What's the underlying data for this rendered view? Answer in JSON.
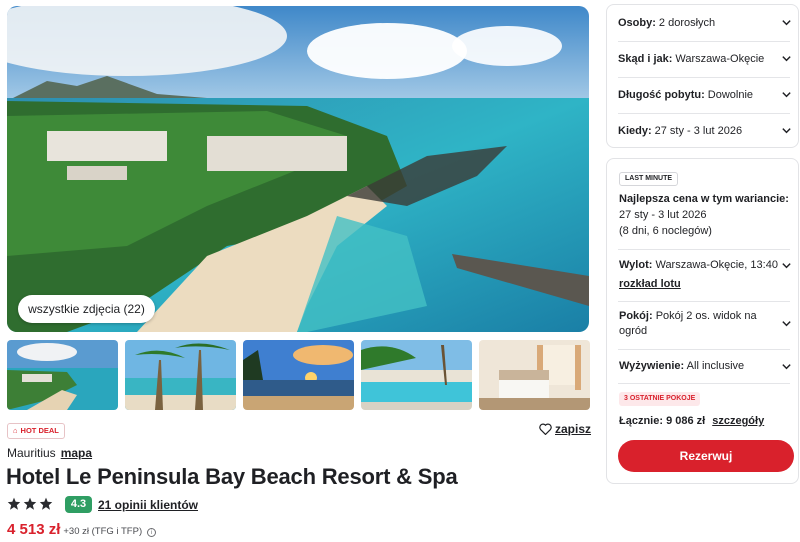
{
  "gallery": {
    "all_photos_label": "wszystkie zdjęcia (22)",
    "thumbnails": [
      "resort-aerial",
      "palm-beach",
      "sunset-beach",
      "pool-area",
      "hotel-room"
    ]
  },
  "hotel": {
    "hot_deal_label": "HOT DEAL",
    "save_label": "zapisz",
    "country": "Mauritius",
    "map_label": "mapa",
    "name": "Hotel Le Peninsula Bay Beach Resort & Spa",
    "stars": 3,
    "rating": "4.3",
    "reviews_label": "21 opinii klientów",
    "price": "4 513 zł",
    "price_extra": "+30 zł (TFG i TFP)"
  },
  "selection": {
    "persons": {
      "label": "Osoby:",
      "value": "2 dorosłych"
    },
    "departure": {
      "label": "Skąd i jak:",
      "value": "Warszawa-Okęcie"
    },
    "duration": {
      "label": "Długość pobytu:",
      "value": "Dowolnie"
    },
    "dates": {
      "label": "Kiedy:",
      "value": "27 sty - 3 lut 2026"
    }
  },
  "offer": {
    "badge": "LAST MINUTE",
    "best_price_label": "Najlepsza cena w tym wariancie:",
    "dates": "27 sty - 3 lut 2026",
    "nights": "(8 dni, 6 noclegów)",
    "flight": {
      "label": "Wylot:",
      "value": "Warszawa-Okęcie, 13:40"
    },
    "flight_schedule_label": "rozkład lotu",
    "room": {
      "label": "Pokój:",
      "value": "Pokój 2 os. widok na ogród"
    },
    "board": {
      "label": "Wyżywienie:",
      "value": "All inclusive"
    },
    "rooms_left_badge": "3 OSTATNIE POKOJE",
    "total_label": "Łącznie: 9 086 zł",
    "details_label": "szczegóły",
    "book_label": "Rezerwuj"
  },
  "colors": {
    "accent": "#d9212c",
    "rating_green": "#2f9e63",
    "text": "#1f2024"
  }
}
